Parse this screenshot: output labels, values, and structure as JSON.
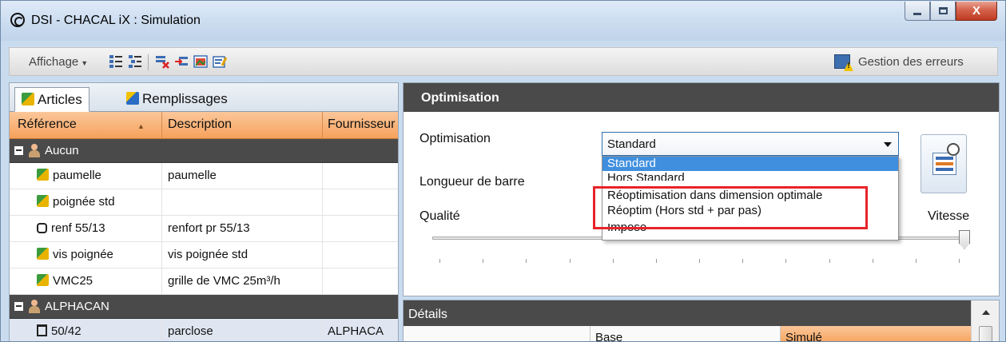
{
  "window": {
    "title": "DSI - CHACAL iX : Simulation",
    "close_label": "X"
  },
  "toolbar": {
    "affichage_label": "Affichage",
    "errors_label": "Gestion des erreurs"
  },
  "left_panel": {
    "tabs": [
      {
        "label": "Articles",
        "icon": "article-icon",
        "active": true
      },
      {
        "label": "Remplissages",
        "icon": "fill-icon",
        "active": false
      }
    ],
    "columns": [
      "Référence",
      "Description",
      "Fournisseur"
    ],
    "groups": [
      {
        "name": "Aucun",
        "rows": [
          {
            "icon": "article-icon",
            "ref": "paumelle",
            "desc": "paumelle",
            "supplier": ""
          },
          {
            "icon": "article-icon",
            "ref": "poignée std",
            "desc": "",
            "supplier": ""
          },
          {
            "icon": "profile-icon",
            "ref": "renf 55/13",
            "desc": "renfort pr 55/13",
            "supplier": ""
          },
          {
            "icon": "article-icon",
            "ref": "vis poignée",
            "desc": "vis poignée std",
            "supplier": ""
          },
          {
            "icon": "article-icon",
            "ref": "VMC25",
            "desc": "grille de VMC 25m³/h",
            "supplier": ""
          }
        ]
      },
      {
        "name": "ALPHACAN",
        "rows": [
          {
            "icon": "glazing-bead-icon",
            "ref": "50/42",
            "desc": "parclose",
            "supplier": "ALPHACA"
          }
        ]
      }
    ]
  },
  "optimisation": {
    "header": "Optimisation",
    "optim_label": "Optimisation",
    "bar_length_label": "Longueur de barre",
    "quality_label": "Qualité",
    "speed_label": "Vitesse",
    "selected": "Standard",
    "options": [
      "Standard",
      "Hors Standard",
      "Réoptimisation dans dimension optimale",
      "Réoptim (Hors std + par pas)",
      "Imposé"
    ],
    "quality_speed_level": 1.0
  },
  "details": {
    "header": "Détails",
    "columns": [
      "",
      "Base",
      "Simulé"
    ]
  },
  "colors": {
    "header_dark": "#4a4a4a",
    "orange_header": "#f6a25c",
    "selection_blue": "#3f8fde",
    "highlight_red": "#e8232a"
  }
}
